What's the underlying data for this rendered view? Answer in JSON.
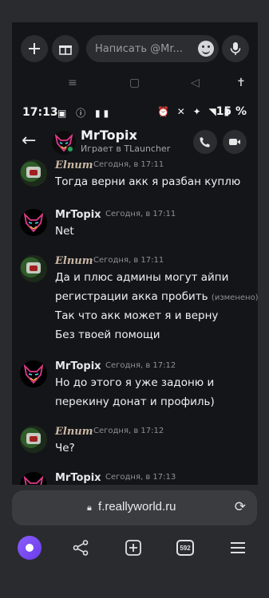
{
  "composer": {
    "placeholder": "Написать @Mr..."
  },
  "status_bar": {
    "time": "17:13",
    "battery": "15 %"
  },
  "chat": {
    "name": "MrTopix",
    "chevron": "›",
    "activity": "Играет в TLauncher",
    "messages": [
      {
        "author": "Elnum",
        "time": "Сегодня, в 17:11",
        "lines": [
          "Тогда верни акк я разбан куплю"
        ]
      },
      {
        "author": "MrTopix",
        "time": "Сегодня, в 17:11",
        "lines": [
          "Net"
        ]
      },
      {
        "author": "Elnum",
        "time": "Сегодня, в 17:11",
        "lines": [
          "Да и плюс админы могут айпи",
          "регистрации акка пробить",
          "Так что акк может я и верну",
          "Без твоей помощи"
        ],
        "edited": "(изменено)"
      },
      {
        "author": "MrTopix",
        "time": "Сегодня, в 17:12",
        "lines": [
          "Но до этого я уже задоню и",
          "перекину донат и профиль)"
        ]
      },
      {
        "author": "Elnum",
        "time": "Сегодня, в 17:12",
        "lines": [
          "Че?"
        ]
      },
      {
        "author": "MrTopix",
        "time": "Сегодня, в 17:13",
        "lines": []
      }
    ]
  },
  "browser": {
    "url": "f.reallyworld.ru",
    "tabs_count": "592"
  },
  "colors": {
    "online": "#23a55a",
    "alice": "#7b4dff"
  },
  "icons": [
    "plus-icon",
    "gift-icon",
    "emoji-icon",
    "mic-icon",
    "back-arrow-icon",
    "call-icon",
    "video-icon",
    "lock-icon",
    "reload-icon",
    "share-icon",
    "new-tab-icon",
    "tabs-icon",
    "menu-icon"
  ]
}
